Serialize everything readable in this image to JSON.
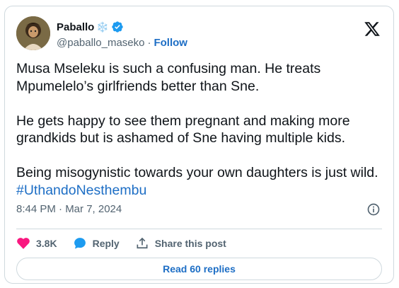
{
  "author": {
    "name": "Paballo",
    "emoji": "❄️",
    "handle": "@paballo_maseko",
    "separator": "·",
    "follow_label": "Follow"
  },
  "tweet": {
    "text": "Musa Mseleku is such a confusing man. He treats Mpumelelo’s girlfriends better than Sne.\n\nHe gets happy to see them pregnant and making more grandkids but is ashamed of Sne having multiple kids.\n\nBeing misogynistic towards your own daughters is just wild. ",
    "hashtag": "#UthandoNesthembu",
    "timestamp": "8:44 PM · Mar 7, 2024"
  },
  "actions": {
    "likes_count": "3.8K",
    "reply_label": "Reply",
    "share_label": "Share this post"
  },
  "footer": {
    "read_replies_label": "Read 60 replies"
  },
  "colors": {
    "link": "#1d6ec5",
    "verified": "#1d9bf0",
    "like": "#f91880",
    "reply": "#1d9bf0",
    "muted": "#536471"
  },
  "icons": [
    "verified-icon",
    "x-logo-icon",
    "info-icon",
    "heart-icon",
    "reply-bubble-icon",
    "share-icon"
  ]
}
